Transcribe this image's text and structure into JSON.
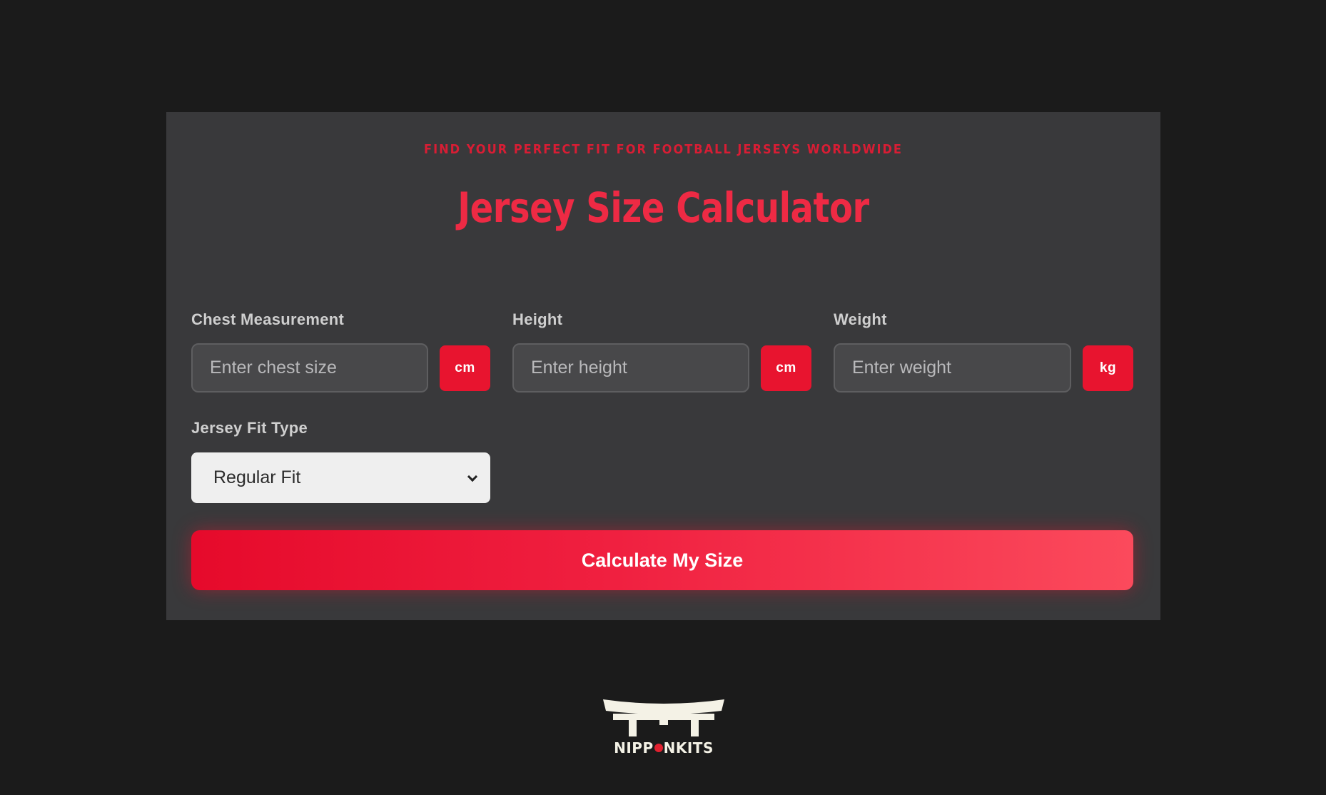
{
  "header": {
    "tagline": "FIND YOUR PERFECT FIT FOR FOOTBALL JERSEYS WORLDWIDE",
    "title": "Jersey Size Calculator"
  },
  "fields": {
    "chest": {
      "label": "Chest Measurement",
      "placeholder": "Enter chest size",
      "unit": "cm"
    },
    "height": {
      "label": "Height",
      "placeholder": "Enter height",
      "unit": "cm"
    },
    "weight": {
      "label": "Weight",
      "placeholder": "Enter weight",
      "unit": "kg"
    }
  },
  "fit_type": {
    "label": "Jersey Fit Type",
    "selected": "Regular Fit"
  },
  "calculate_button": "Calculate My Size",
  "footer": {
    "logo_text_before": "NIPP",
    "logo_text_after": "NKITS"
  },
  "colors": {
    "background": "#1b1b1b",
    "card": "#39393b",
    "accent": "#e8142f",
    "logo": "#f4f2e6"
  }
}
